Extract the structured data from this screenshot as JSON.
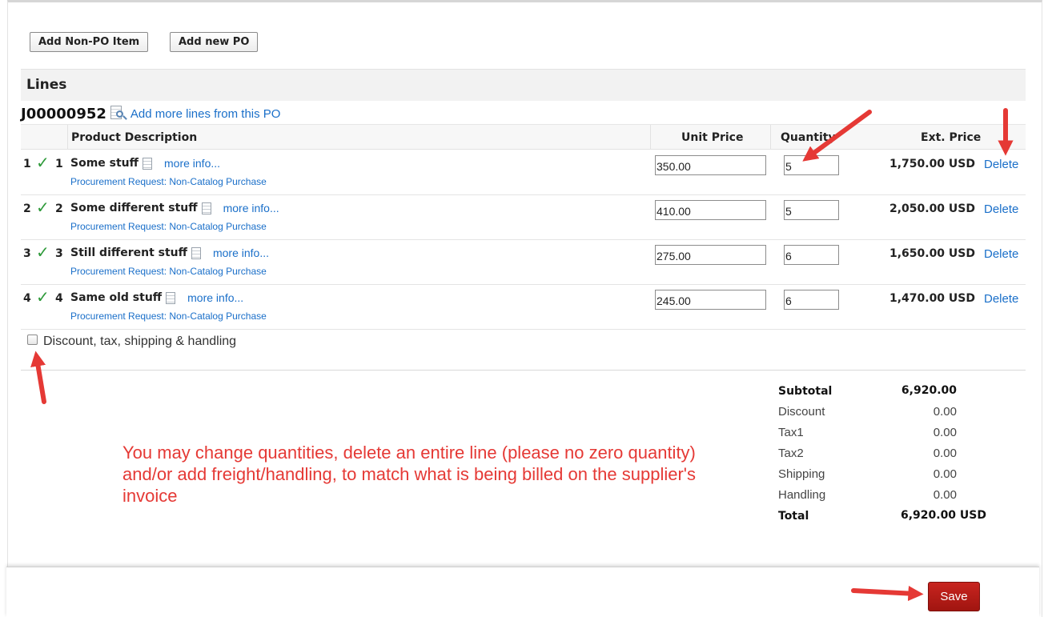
{
  "toolbar": {
    "add_non_po_label": "Add Non-PO Item",
    "add_new_po_label": "Add new PO"
  },
  "section": {
    "title": "Lines"
  },
  "po": {
    "number": "J00000952",
    "add_lines_link": "Add more lines from this PO"
  },
  "table": {
    "headers": {
      "description": "Product Description",
      "unit_price": "Unit Price",
      "quantity": "Quantity",
      "ext_price": "Ext. Price"
    },
    "rows": [
      {
        "line": "1",
        "po_line": "1",
        "description": "Some stuff",
        "more_info": "more info...",
        "request": "Procurement Request: Non-Catalog Purchase",
        "unit_price": "350.00",
        "quantity": "5",
        "ext_price": "1,750.00 USD",
        "delete": "Delete"
      },
      {
        "line": "2",
        "po_line": "2",
        "description": "Some different stuff",
        "more_info": "more info...",
        "request": "Procurement Request: Non-Catalog Purchase",
        "unit_price": "410.00",
        "quantity": "5",
        "ext_price": "2,050.00 USD",
        "delete": "Delete"
      },
      {
        "line": "3",
        "po_line": "3",
        "description": "Still different stuff",
        "more_info": "more info...",
        "request": "Procurement Request: Non-Catalog Purchase",
        "unit_price": "275.00",
        "quantity": "6",
        "ext_price": "1,650.00 USD",
        "delete": "Delete"
      },
      {
        "line": "4",
        "po_line": "4",
        "description": "Same old stuff",
        "more_info": "more info...",
        "request": "Procurement Request: Non-Catalog Purchase",
        "unit_price": "245.00",
        "quantity": "6",
        "ext_price": "1,470.00 USD",
        "delete": "Delete"
      }
    ]
  },
  "discount_checkbox": {
    "label": "Discount, tax, shipping & handling",
    "checked": false
  },
  "totals": {
    "subtotal_label": "Subtotal",
    "subtotal": "6,920.00",
    "discount_label": "Discount",
    "discount": "0.00",
    "tax1_label": "Tax1",
    "tax1": "0.00",
    "tax2_label": "Tax2",
    "tax2": "0.00",
    "shipping_label": "Shipping",
    "shipping": "0.00",
    "handling_label": "Handling",
    "handling": "0.00",
    "total_label": "Total",
    "total": "6,920.00 USD"
  },
  "annotation": {
    "note": "You may change quantities, delete an entire line (please no zero quantity) and/or add freight/handling, to match what is being billed on the supplier's invoice",
    "color": "#e53935"
  },
  "footer": {
    "save_label": "Save"
  },
  "colors": {
    "link": "#1a6fc9",
    "save_button": "#b81c17",
    "check": "#2e9a3a"
  }
}
